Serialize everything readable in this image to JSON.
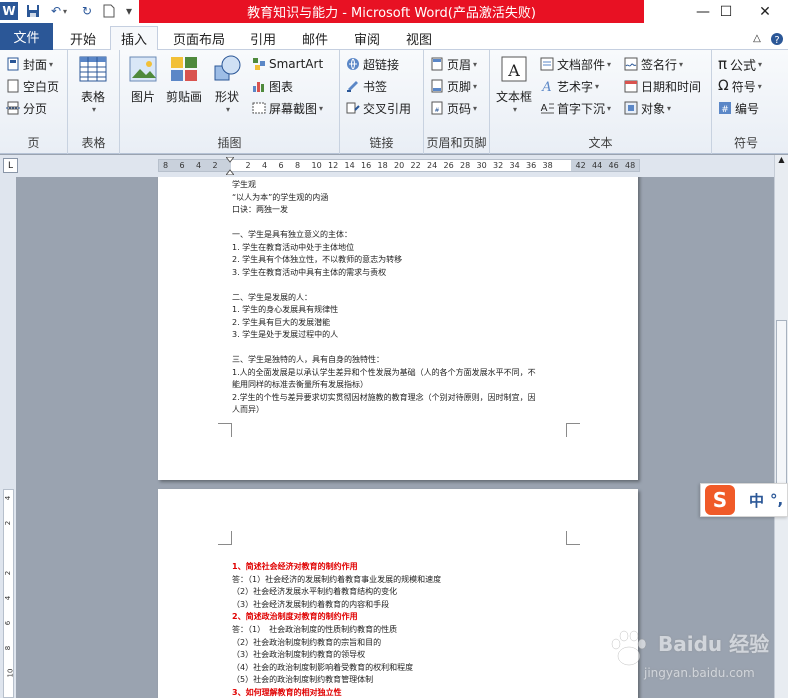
{
  "window": {
    "title": "教育知识与能力 - Microsoft Word(产品激活失败)",
    "minimize": "—",
    "maximize": "☐",
    "close": "✕"
  },
  "tabs": {
    "file": "文件",
    "items": [
      "开始",
      "插入",
      "页面布局",
      "引用",
      "邮件",
      "审阅",
      "视图"
    ],
    "active": "插入"
  },
  "ribbon": {
    "pages": {
      "label": "页",
      "cover": "封面",
      "blank": "空白页",
      "break": "分页"
    },
    "table": {
      "label": "表格",
      "btn": "表格"
    },
    "illustrations": {
      "label": "插图",
      "picture": "图片",
      "clipart": "剪贴画",
      "shapes": "形状",
      "smartart": "SmartArt",
      "chart": "图表",
      "screenshot": "屏幕截图"
    },
    "links": {
      "label": "链接",
      "hyperlink": "超链接",
      "bookmark": "书签",
      "crossref": "交叉引用"
    },
    "headerfooter": {
      "label": "页眉和页脚",
      "header": "页眉",
      "footer": "页脚",
      "pagenum": "页码"
    },
    "text": {
      "label": "文本",
      "textbox": "文本框",
      "quickparts": "文档部件",
      "wordart": "艺术字",
      "dropcap": "首字下沉",
      "signature": "签名行",
      "datetime": "日期和时间",
      "object": "对象"
    },
    "symbols": {
      "label": "符号",
      "equation": "公式",
      "symbol": "符号",
      "number": "编号"
    }
  },
  "ruler": {
    "ticks": [
      "8",
      "6",
      "4",
      "2",
      "",
      "2",
      "4",
      "6",
      "8",
      "10",
      "12",
      "14",
      "16",
      "18",
      "20",
      "22",
      "24",
      "26",
      "28",
      "30",
      "32",
      "34",
      "36",
      "38",
      "",
      "42",
      "44",
      "46",
      "48"
    ],
    "vticks": [
      "4",
      "2",
      "",
      "2",
      "4",
      "6",
      "8",
      "10"
    ]
  },
  "page1": {
    "lines": [
      "学生观",
      "“以人为本”的学生观的内涵",
      "口诀：两独一发",
      "",
      "一、学生是具有独立意义的主体：",
      "1. 学生在教育活动中处于主体地位",
      "2. 学生具有个体独立性，不以教师的意志为转移",
      "3. 学生在教育活动中具有主体的需求与责权",
      "",
      "二、学生是发展的人：",
      "1. 学生的身心发展具有规律性",
      "2. 学生具有巨大的发展潜能",
      "3. 学生是处于发展过程中的人",
      "",
      "三、学生是独特的人，具有自身的独特性：",
      "1.人的全面发展是以承认学生差异和个性发展为基础（人的各个方面发展水平不同，不",
      "能用同样的标准去衡量所有发展指标）",
      "2.学生的个性与差异要求切实贯彻因材施教的教育理念（个别对待原则，因时制宜，因",
      "人而异）"
    ]
  },
  "page2": {
    "lines": [
      {
        "text": "1、简述社会经济对教育的制约作用",
        "red": true
      },
      {
        "text": "答：（1）社会经济的发展制约着教育事业发展的规模和速度",
        "red": false
      },
      {
        "text": "（2）社会经济发展水平制约着教育结构的变化",
        "red": false
      },
      {
        "text": "（3）社会经济发展制约着教育的内容和手段",
        "red": false
      },
      {
        "text": "2、简述政治制度对教育的制约作用",
        "red": true
      },
      {
        "text": "答：（1）　社会政治制度的性质制约教育的性质",
        "red": false
      },
      {
        "text": "（2）社会政治制度制约教育的宗旨和目的",
        "red": false
      },
      {
        "text": "（3）社会政治制度制约教育的领导权",
        "red": false
      },
      {
        "text": "（4）社会的政治制度制影响着受教育的权利和程度",
        "red": false
      },
      {
        "text": "（5）社会的政治制度制约教育管理体制",
        "red": false
      },
      {
        "text": "3、如何理解教育的相对独立性",
        "red": true
      }
    ]
  },
  "ime": {
    "mode": "中",
    "punct": "°,"
  },
  "watermark": {
    "text": "Baidu 经验",
    "url": "jingyan.baidu.com"
  },
  "colors": {
    "accent": "#2b5797",
    "title_bg": "#e81123",
    "heading_red": "#e00000"
  }
}
